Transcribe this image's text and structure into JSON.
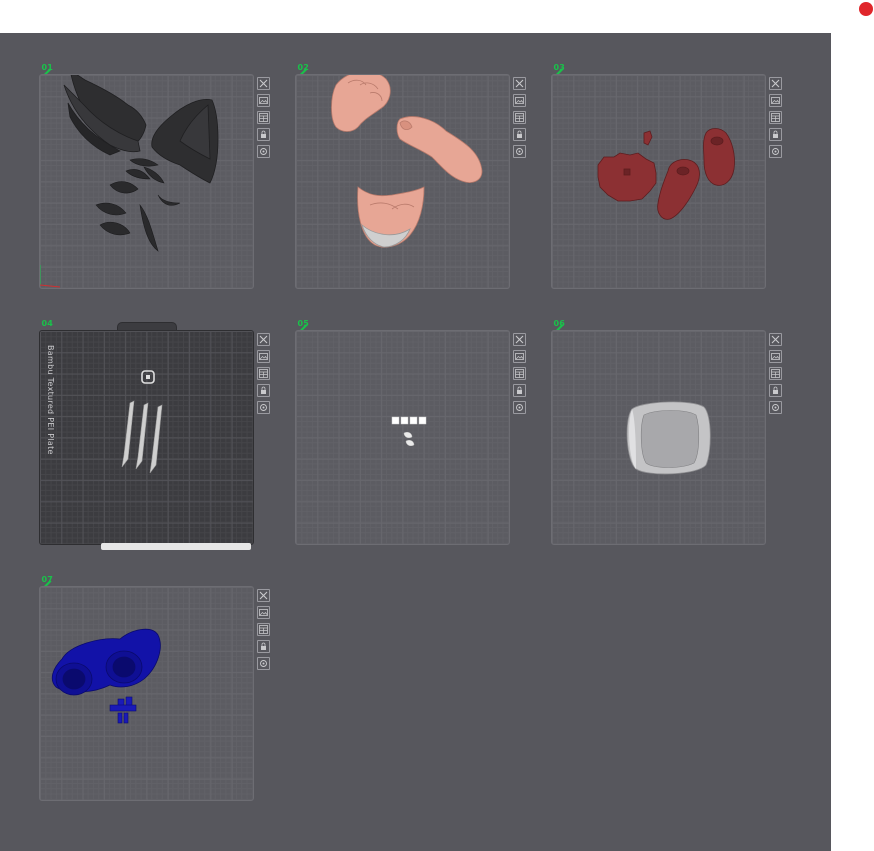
{
  "window": {
    "recording_indicator": "record-dot",
    "accent": "#e0262b"
  },
  "canvas": {
    "background": "#57575d",
    "plate_number_color": "#19c24a"
  },
  "plate_tools": [
    "close-icon",
    "image-icon",
    "arrange-icon",
    "lock-icon",
    "settings-icon"
  ],
  "plates": [
    {
      "number": "01",
      "model_color": "#2e2e30",
      "content": "wings-and-feathers"
    },
    {
      "number": "02",
      "model_color": "#e7a695",
      "content": "arms-and-head"
    },
    {
      "number": "03",
      "model_color": "#8c3033",
      "content": "boots-and-base"
    },
    {
      "number": "04",
      "model_color": "#cfcfcf",
      "content": "claws",
      "plate_label": "Bambu Textured PEI Plate"
    },
    {
      "number": "05",
      "model_color": "#ffffff",
      "content": "small-parts"
    },
    {
      "number": "06",
      "model_color": "#c4c4c6",
      "content": "ring-part"
    },
    {
      "number": "07",
      "model_color": "#1212a8",
      "content": "blue-parts"
    }
  ]
}
